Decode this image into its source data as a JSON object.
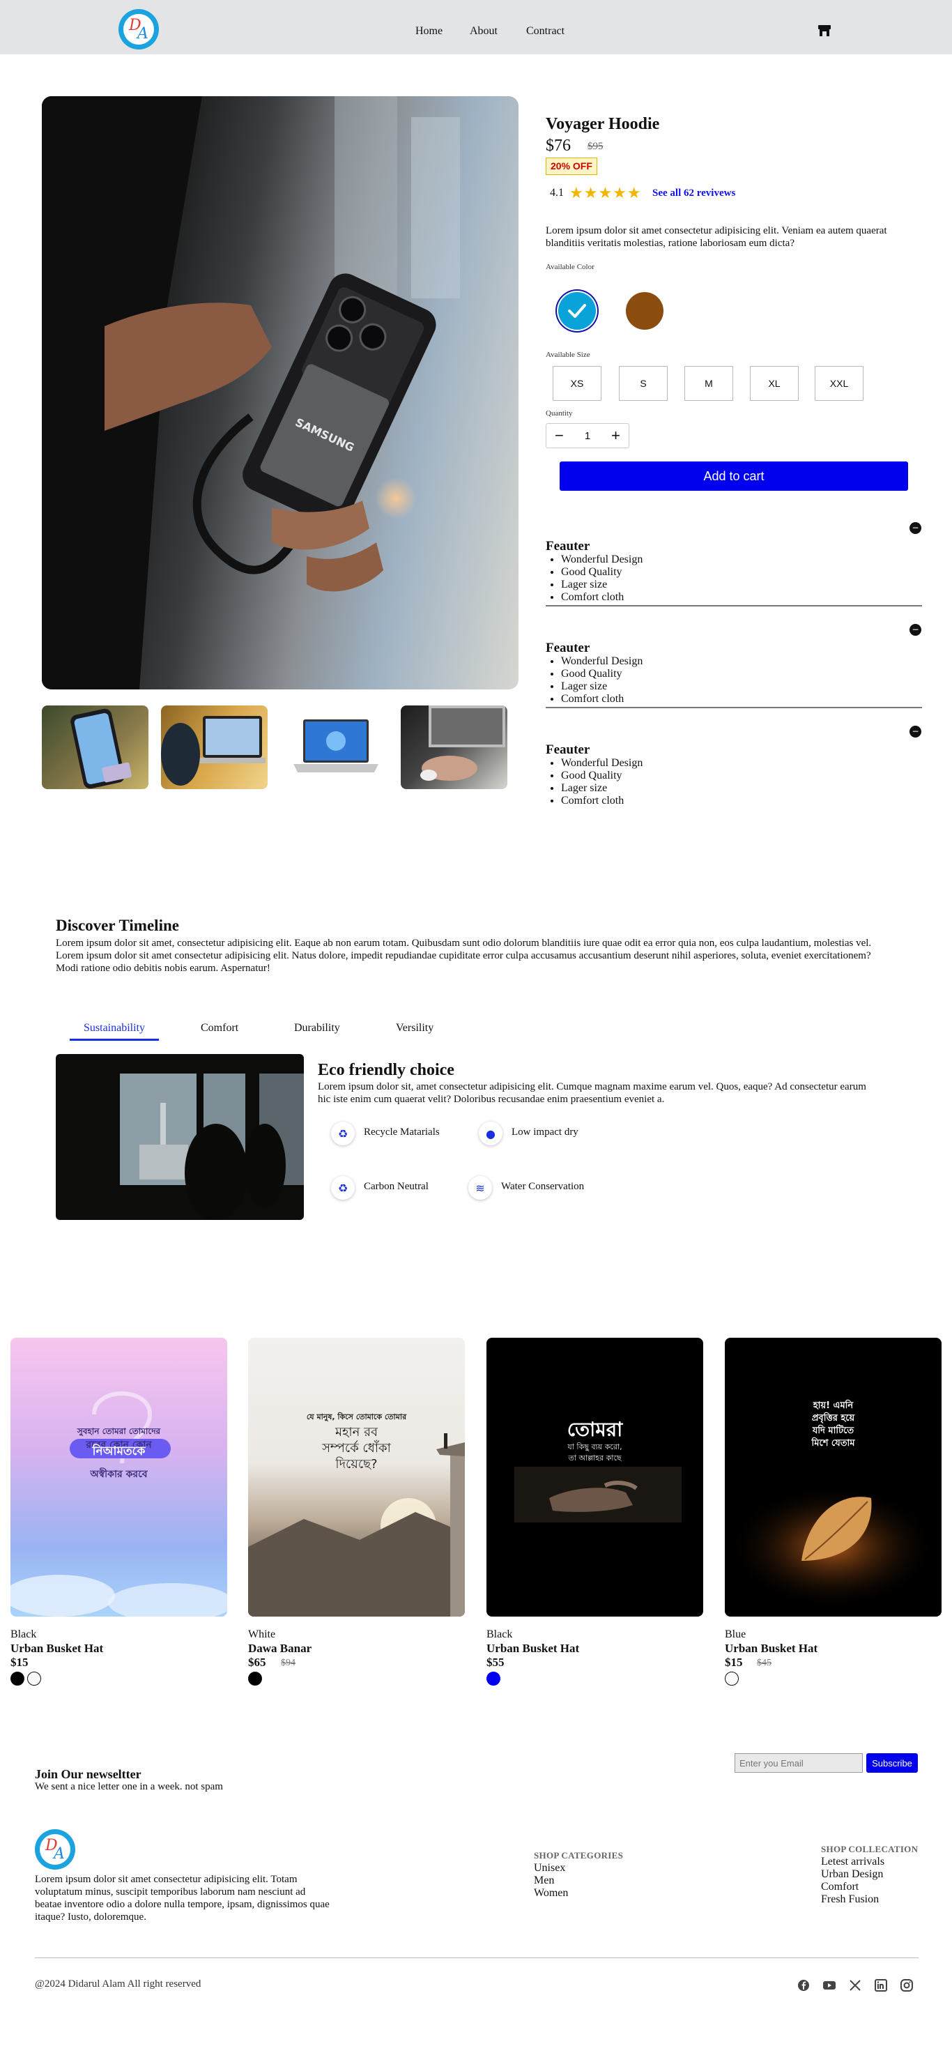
{
  "header": {
    "logo_letters": "DA",
    "nav": [
      "Home",
      "About",
      "Contract"
    ]
  },
  "product": {
    "title": "Voyager Hoodie",
    "price": "$76",
    "old_price": "$95",
    "discount_badge": "20% OFF",
    "rating": "4.1",
    "stars": "★★★★★",
    "reviews_link": "See all 62 revivews",
    "description": "Lorem ipsum dolor sit amet consectetur adipisicing elit. Veniam ea autem quaerat blanditiis veritatis molestias, ratione laboriosam eum dicta?",
    "color_label": "Available Color",
    "colors": [
      "#0aa3d9",
      "#8a4d0f"
    ],
    "size_label": "Available Size",
    "sizes": [
      "XS",
      "S",
      "M",
      "XL",
      "XXL"
    ],
    "quantity_label": "Quantity",
    "quantity": "1",
    "add_to_cart": "Add to cart",
    "main_image_brand": "SAMSUNG",
    "features": [
      {
        "title": "Feauter",
        "items": [
          "Wonderful Design",
          "Good Quality",
          "Lager size",
          "Comfort cloth"
        ]
      },
      {
        "title": "Feauter",
        "items": [
          "Wonderful Design",
          "Good Quality",
          "Lager size",
          "Comfort cloth"
        ]
      },
      {
        "title": "Feauter",
        "items": [
          "Wonderful Design",
          "Good Quality",
          "Lager size",
          "Comfort cloth"
        ]
      }
    ]
  },
  "timeline": {
    "title": "Discover Timeline",
    "text": "Lorem ipsum dolor sit amet, consectetur adipisicing elit. Eaque ab non earum totam. Quibusdam sunt odio dolorum blanditiis iure quae odit ea error quia non, eos culpa laudantium, molestias vel. Lorem ipsum dolor sit amet consectetur adipisicing elit. Natus dolore, impedit repudiandae cupiditate error culpa accusamus accusantium deserunt nihil asperiores, soluta, eveniet exercitationem? Modi ratione odio debitis nobis earum. Aspernatur!",
    "tabs": [
      "Sustainability",
      "Comfort",
      "Durability",
      "Versility"
    ],
    "active_tab": "Sustainability",
    "eco_title": "Eco friendly choice",
    "eco_text": "Lorem ipsum dolor sit, amet consectetur adipisicing elit. Cumque magnam maxime earum vel. Quos, eaque? Ad consectetur earum hic iste enim cum quaerat velit? Doloribus recusandae enim praesentium eveniet a.",
    "eco_items": [
      "Recycle Matarials",
      "Low impact dry",
      "Carbon Neutral",
      "Water Conservation"
    ],
    "accent": "#1a2fe0"
  },
  "products": [
    {
      "color": "Black",
      "name": "Urban Busket Hat",
      "price": "$15",
      "old_price": "",
      "image_text": [
        "সুবহান তোমরা তোমাদের",
        "রবের কোন কোন",
        "নিআমতকে",
        "অস্বীকার করবে"
      ]
    },
    {
      "color": "White",
      "name": "Dawa Banar",
      "price": "$65",
      "old_price": "$94",
      "image_text": [
        "যে মানুষ, কিসে তোমাকে তোমার",
        "মহান রব",
        "সম্পর্কে ধোঁকা",
        "দিয়েছে?"
      ]
    },
    {
      "color": "Black",
      "name": "Urban Busket Hat",
      "price": "$55",
      "old_price": "",
      "image_text": [
        "তোমরা",
        "যা কিছু ব্যয় করো,",
        "তা আল্লাহর কাছে"
      ]
    },
    {
      "color": "Blue",
      "name": "Urban Busket Hat",
      "price": "$15",
      "old_price": "$45",
      "image_text": [
        "হায়! এমনি",
        "প্রবৃত্তির হয়ে",
        "যদি মাটিতে",
        "মিশে যেতাম"
      ]
    }
  ],
  "newsletter": {
    "title": "Join Our newseltter",
    "subtitle": "We sent a nice letter one in a week. not spam",
    "placeholder": "Enter you Email",
    "button": "Subscribe"
  },
  "footer": {
    "text": "Lorem ipsum dolor sit amet consectetur adipisicing elit. Totam voluptatum minus, suscipit temporibus laborum nam nesciunt ad beatae inventore odio a dolore nulla tempore, ipsam, dignissimos quae itaque? Iusto, doloremque.",
    "categories_title": "SHOP CATEGORIES",
    "categories": [
      "Unisex",
      "Men",
      "Women"
    ],
    "collection_title": "SHOP COLLECATION",
    "collections": [
      "Letest arrivals",
      "Urban Design",
      "Comfort",
      "Fresh Fusion"
    ],
    "copyright": "@2024 Didarul Alam All right reserved"
  }
}
